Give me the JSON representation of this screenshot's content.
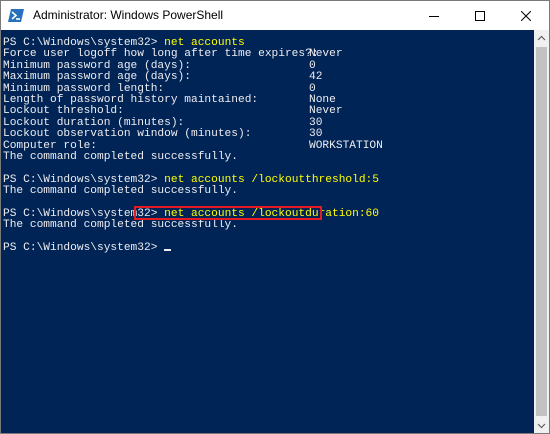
{
  "window": {
    "title": "Administrator: Windows PowerShell"
  },
  "icons": {
    "app": "powershell-icon",
    "minimize": "minimize-icon",
    "maximize": "maximize-icon",
    "close": "close-icon",
    "scroll_up": "chevron-up-icon",
    "scroll_down": "chevron-down-icon"
  },
  "colors": {
    "console_background": "#012456",
    "console_text": "#eeedf0",
    "command_text": "#ffff00",
    "highlight_border": "#e51b23"
  },
  "console": {
    "block1": {
      "prompt": "PS C:\\Windows\\system32> ",
      "command": "net accounts",
      "rows": [
        {
          "label": "Force user logoff how long after time expires?:",
          "value": "Never"
        },
        {
          "label": "Minimum password age (days):",
          "value": "0"
        },
        {
          "label": "Maximum password age (days):",
          "value": "42"
        },
        {
          "label": "Minimum password length:",
          "value": "0"
        },
        {
          "label": "Length of password history maintained:",
          "value": "None"
        },
        {
          "label": "Lockout threshold:",
          "value": "Never"
        },
        {
          "label": "Lockout duration (minutes):",
          "value": "30"
        },
        {
          "label": "Lockout observation window (minutes):",
          "value": "30"
        },
        {
          "label": "Computer role:",
          "value": "WORKSTATION"
        }
      ],
      "result": "The command completed successfully."
    },
    "block2": {
      "prompt": "PS C:\\Windows\\system32> ",
      "command": "net accounts /lockoutthreshold:5",
      "result": "The command completed successfully."
    },
    "block3": {
      "prompt": "PS C:\\Windows\\system32> ",
      "command": "net accounts /lockoutduration:60",
      "result": "The command completed successfully."
    },
    "current_prompt": "PS C:\\Windows\\system32> "
  }
}
